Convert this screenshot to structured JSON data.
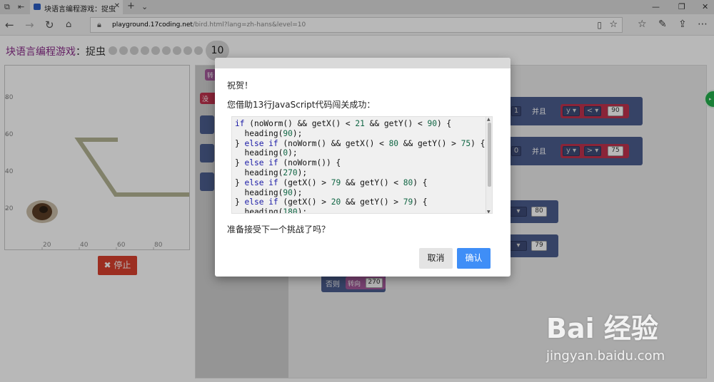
{
  "browser": {
    "tab_title": "块语言编程游戏：捉虫",
    "url_host": "playground.17coding.net",
    "url_path": "/bird.html?lang=zh-hans&level=10"
  },
  "game": {
    "title_prefix": "块语言编程游戏",
    "title_sep": "：",
    "title_level_name": "捉虫",
    "level_count": 9,
    "current_level": "10",
    "stop_label": "停止",
    "axis_y": [
      "80",
      "60",
      "40",
      "20"
    ],
    "axis_x": [
      "20",
      "40",
      "60",
      "80"
    ]
  },
  "blocks": {
    "and_label_1": "并且",
    "and_label_2": "并且",
    "var_y_1": "y ▾",
    "op_lt": "< ▾",
    "num_90": "90",
    "var_y_2": "y ▾",
    "op_gt": "> ▾",
    "num_75": "75",
    "num_80": "80",
    "num_79": "79",
    "else_label": "否则",
    "turn_label": "转向",
    "turn_value": "270",
    "left_num_1": "1",
    "left_num_2": "0",
    "tb_1": "转",
    "tb_2": "没"
  },
  "dialog": {
    "congrats": "祝贺！",
    "message": "您借助13行JavaScript代码闯关成功：",
    "question": "准备接受下一个挑战了吗？",
    "cancel_label": "取消",
    "ok_label": "确认"
  },
  "watermark": {
    "brand": "Bai 经验",
    "url": "jingyan.baidu.com"
  },
  "colors": {
    "title_purple": "#8b2d8b",
    "stop_red": "#d9412e",
    "ok_blue": "#3f8ef7",
    "block_navy": "#4c5d8e",
    "block_purple": "#a55b9c"
  }
}
